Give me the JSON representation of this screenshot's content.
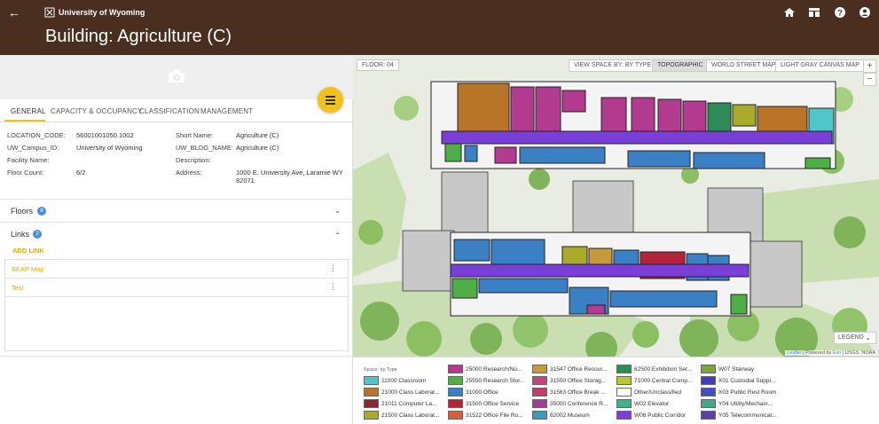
{
  "header": {
    "brand": "University of Wyoming",
    "title": "Building: Agriculture (C)"
  },
  "tabs": [
    "GENERAL",
    "CAPACITY & OCCUPANCY",
    "CLASSIFICATION",
    "MANAGEMENT"
  ],
  "general": {
    "left": [
      {
        "label": "LOCATION_CODE:",
        "value": "56001001050.1002"
      },
      {
        "label": "UW_Campus_ID:",
        "value": "University of Wyoming"
      },
      {
        "label": "Facility Name:",
        "value": ""
      },
      {
        "label": "Floor Count:",
        "value": "6/2"
      }
    ],
    "right": [
      {
        "label": "Short Name:",
        "value": "Agriculture (C)"
      },
      {
        "label": "UW_BLDG_NAME:",
        "value": "Agriculture (C)"
      },
      {
        "label": "Description:",
        "value": ""
      },
      {
        "label": "Address:",
        "value": "1000 E. University Ave, Laramie WY 82071"
      }
    ]
  },
  "sections": {
    "floors": {
      "label": "Floors",
      "count": "8"
    },
    "links": {
      "label": "Links",
      "count": "2"
    }
  },
  "add_link": "ADD LINK",
  "links": [
    "BEAP Map",
    "Test"
  ],
  "map": {
    "floor": "FLOOR: 04",
    "view_space": "VIEW SPACE BY: BY TYPE",
    "basemaps": [
      "TOPOGRAPHIC",
      "WORLD STREET MAP",
      "LIGHT GRAY CANVAS MAP"
    ],
    "selected_basemap": "TOPOGRAPHIC",
    "zoom_in": "+",
    "zoom_out": "−",
    "legend_button": "LEGEND",
    "attribution_leaflet": "Leaflet",
    "attribution_rest": " | Powered by ",
    "attribution_esri": "Esri",
    "attribution_tail": " | USGS, NOAA"
  },
  "legend": {
    "title": "Space: by Type",
    "columns": [
      [
        {
          "label": "11000 Classroom",
          "color": "#4fc6c8"
        },
        {
          "label": "21000 Class Laborat...",
          "color": "#b87427"
        },
        {
          "label": "21011 Computer La...",
          "color": "#8e2333"
        },
        {
          "label": "21500 Class Laborat...",
          "color": "#a8ac2a"
        }
      ],
      [
        {
          "label": "25000 Research/No...",
          "color": "#b23b8f"
        },
        {
          "label": "25550 Research Stor...",
          "color": "#4fae46"
        },
        {
          "label": "31000 Office",
          "color": "#3b7fc4"
        },
        {
          "label": "31500 Office Service",
          "color": "#b3243a"
        },
        {
          "label": "31522 Office File Ro...",
          "color": "#d2633c"
        }
      ],
      [
        {
          "label": "31547 Office Resour...",
          "color": "#c79a3c"
        },
        {
          "label": "31550 Office Storag...",
          "color": "#c0457a"
        },
        {
          "label": "31563 Office Break ...",
          "color": "#c53c6a"
        },
        {
          "label": "35000 Conference R...",
          "color": "#a23c96"
        },
        {
          "label": "62002 Museum",
          "color": "#3f98b8"
        }
      ],
      [
        {
          "label": "62500 Exhibition Ser...",
          "color": "#2e8b57"
        },
        {
          "label": "71000 Central Comp...",
          "color": "#b9c53c"
        },
        {
          "label": "Other/Unclassified",
          "color": "#ffffff"
        },
        {
          "label": "W02 Elevator",
          "color": "#3fb08c"
        },
        {
          "label": "W06 Public Corridor",
          "color": "#7a3fd8"
        }
      ],
      [
        {
          "label": "W07 Stairway",
          "color": "#7aa63c"
        },
        {
          "label": "X01 Custodial Suppl...",
          "color": "#3f3fb8"
        },
        {
          "label": "X03 Public Rest Room",
          "color": "#3f4fc4"
        },
        {
          "label": "Y04 Utility/Mechani...",
          "color": "#3fa88f"
        },
        {
          "label": "Y05 Telecommunicat...",
          "color": "#5a3fa8"
        }
      ]
    ]
  }
}
